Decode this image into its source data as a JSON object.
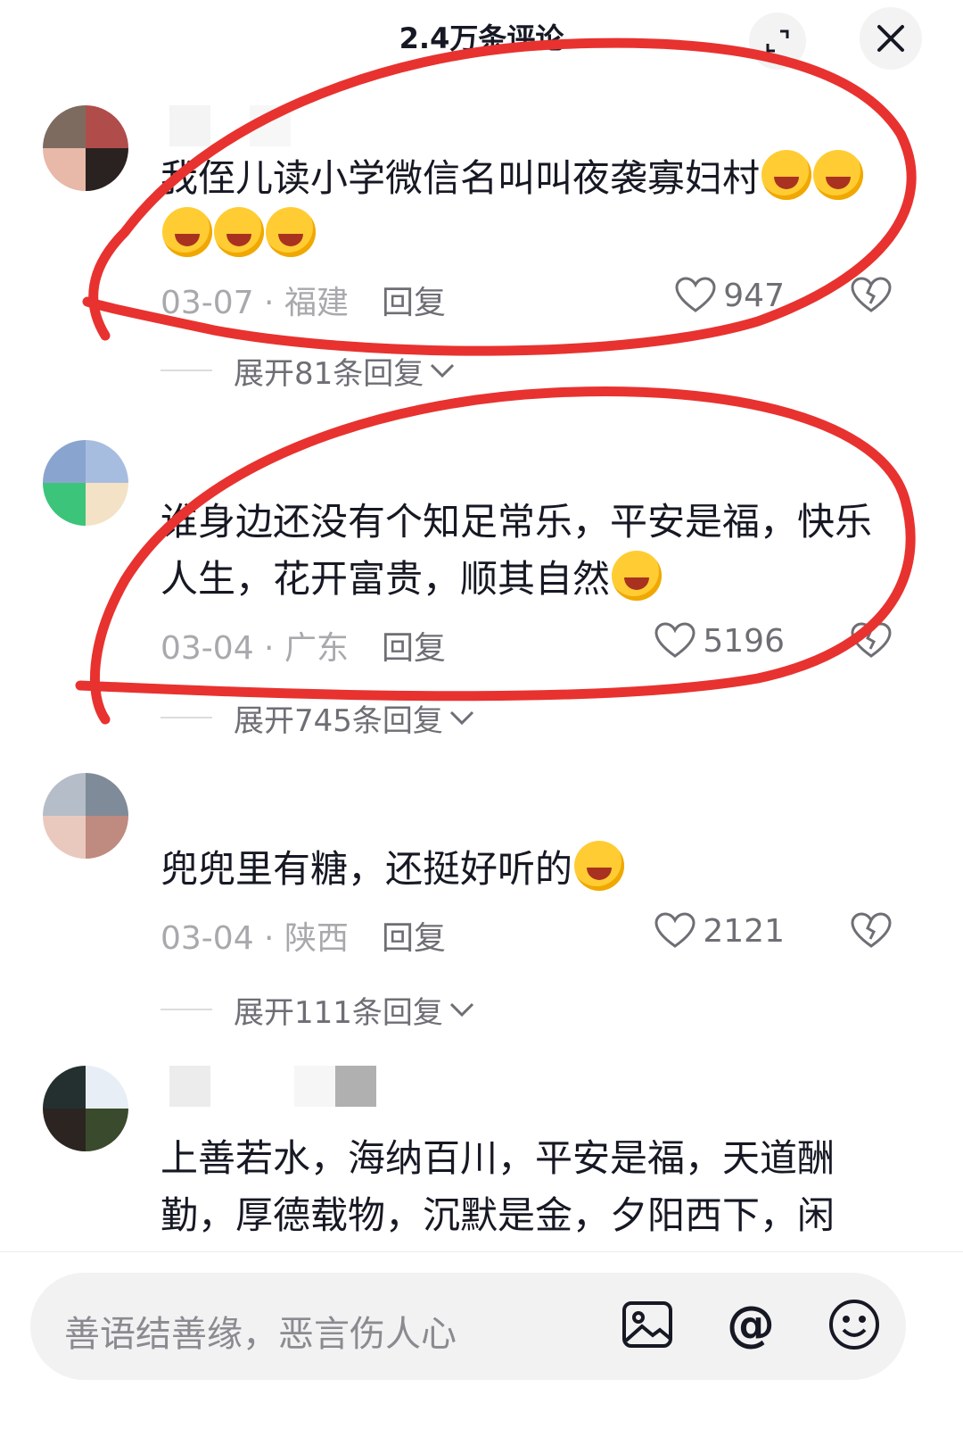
{
  "header": {
    "title": "2.4万条评论",
    "expand_icon": "expand-icon",
    "close_icon": "close-icon"
  },
  "comments": [
    {
      "content": "我侄儿读小学微信名叫叫夜袭寡妇村",
      "date": "03-07 · 福建",
      "reply": "回复",
      "likes": "947",
      "expand": "展开81条回复"
    },
    {
      "content": "谁身边还没有个知足常乐，平安是福，快乐人生，花开富贵，顺其自然",
      "date": "03-04 · 广东",
      "reply": "回复",
      "likes": "5196",
      "expand": "展开745条回复"
    },
    {
      "content": "兜兜里有糖，还挺好听的",
      "date": "03-04 · 陕西",
      "reply": "回复",
      "likes": "2121",
      "expand": "展开111条回复"
    },
    {
      "content": "上善若水，海纳百川，平安是福，天道酬勤，厚德载物，沉默是金，夕阳西下，闲"
    }
  ],
  "input": {
    "placeholder": "善语结善缘，恶言伤人心"
  },
  "colors": {
    "annotation": "#e8322f",
    "emoji": "#ffcc33",
    "muted_text": "#a8a8ad"
  }
}
